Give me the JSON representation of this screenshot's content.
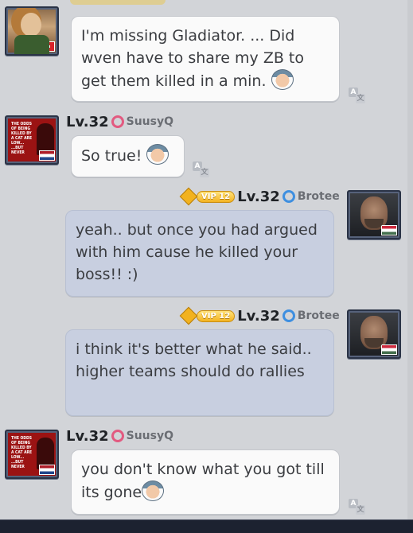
{
  "messages": [
    {
      "id": "m1",
      "side": "left",
      "text": "I'm missing Gladiator. ... Did wven have to share my ZB to get them killed in a min.",
      "avatar": "game-character-avatar",
      "flag": "switzerland"
    },
    {
      "id": "m2",
      "side": "left",
      "level": "Lv.32",
      "username": "SuusyQ",
      "gender": "female",
      "text": "So true!",
      "avatar": "poster-avatar",
      "flag": "netherlands"
    },
    {
      "id": "m3",
      "side": "right",
      "vip": "VIP 12",
      "level": "Lv.32",
      "username": "Brotee",
      "gender": "male",
      "text": "yeah.. but once you had argued with him cause he killed your boss!! :)",
      "avatar": "man-portrait-avatar",
      "flag": "hungary"
    },
    {
      "id": "m4",
      "side": "right",
      "vip": "VIP 12",
      "level": "Lv.32",
      "username": "Brotee",
      "gender": "male",
      "text": "i think it's better what he said.. higher teams should do rallies",
      "avatar": "man-portrait-avatar",
      "flag": "hungary"
    },
    {
      "id": "m5",
      "side": "left",
      "level": "Lv.32",
      "username": "SuusyQ",
      "gender": "female",
      "text": "you don't know what you got till its gone",
      "avatar": "poster-avatar",
      "flag": "netherlands"
    }
  ],
  "poster_text": "THE ODDS OF BEING KILLED BY A CAT ARE LOW... ...BUT NEVER",
  "translate_glyphs": {
    "a": "A",
    "b": "文"
  },
  "colors": {
    "background": "#d2d4d8",
    "incoming_bubble": "#fafafa",
    "outgoing_bubble": "#c8cfe0",
    "vip_gold": "#f3b21f"
  }
}
